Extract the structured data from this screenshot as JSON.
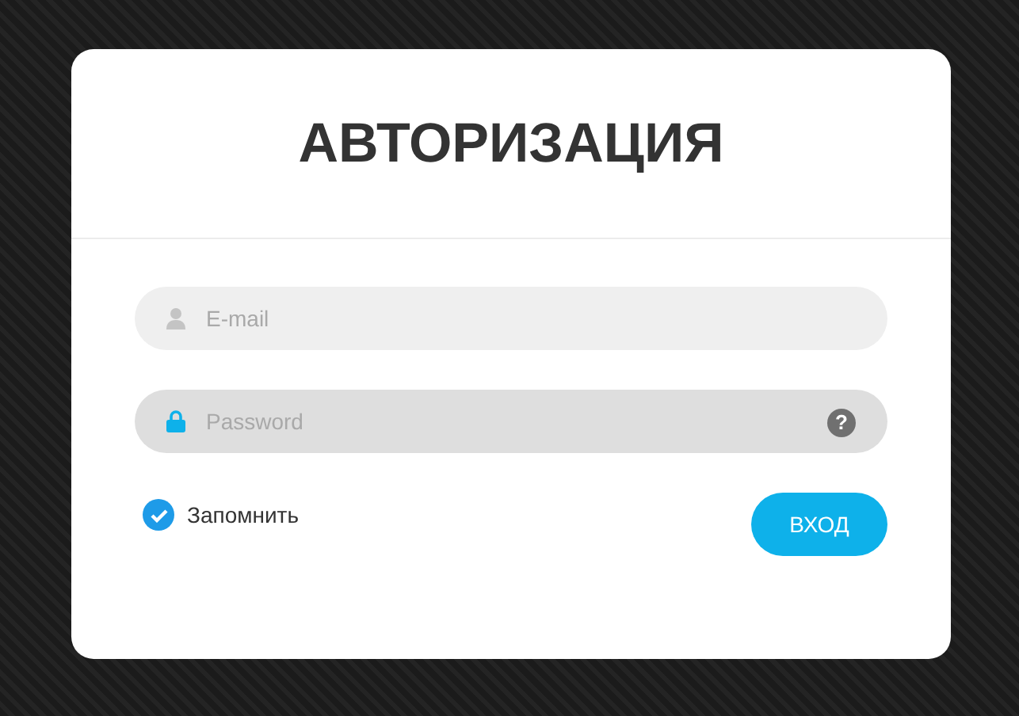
{
  "title": "АВТОРИЗАЦИЯ",
  "fields": [
    {
      "kind": "email",
      "placeholder": "E-mail",
      "focused": false
    },
    {
      "kind": "password",
      "placeholder": "Password",
      "focused": true,
      "help": "?"
    }
  ],
  "remember": {
    "label": "Запомнить",
    "checked": true
  },
  "submit": "ВХОД"
}
